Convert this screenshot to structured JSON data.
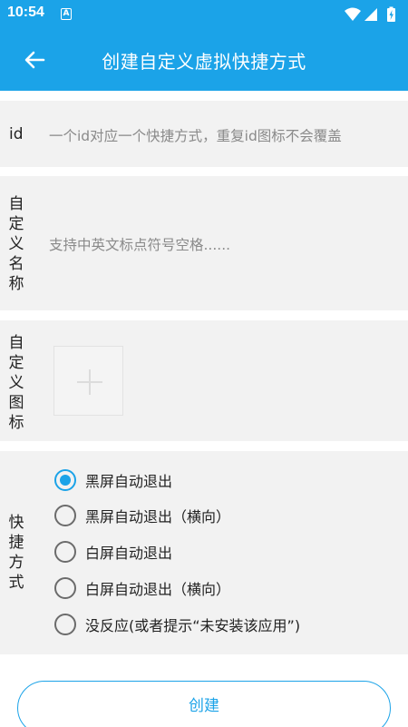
{
  "status_bar": {
    "time": "10:54",
    "notification_letter": "A"
  },
  "app_bar": {
    "title": "创建自定义虚拟快捷方式"
  },
  "id_field": {
    "label": "id",
    "placeholder": "一个id对应一个快捷方式，重复id图标不会覆盖",
    "value": ""
  },
  "name_field": {
    "label_chars": [
      "自",
      "定",
      "义",
      "名",
      "称"
    ],
    "placeholder": "支持中英文标点符号空格......",
    "value": ""
  },
  "icon_field": {
    "label_chars": [
      "自",
      "定",
      "义",
      "图",
      "标"
    ]
  },
  "shortcut_type": {
    "label_chars": [
      "快",
      "捷",
      "方",
      "式"
    ],
    "selected_index": 0,
    "options": [
      "黑屏自动退出",
      "黑屏自动退出（横向）",
      "白屏自动退出",
      "白屏自动退出（横向）",
      "没反应(或者提示“未安装该应用”)"
    ]
  },
  "create_button": {
    "label": "创建"
  },
  "colors": {
    "accent": "#1ba3e8",
    "card_bg": "#f2f2f2",
    "placeholder": "#8a8a8a"
  },
  "icons": {
    "back": "arrow-left-icon",
    "wifi": "wifi-icon",
    "signal": "signal-icon",
    "battery": "battery-charging-icon",
    "add_image": "plus-icon"
  }
}
